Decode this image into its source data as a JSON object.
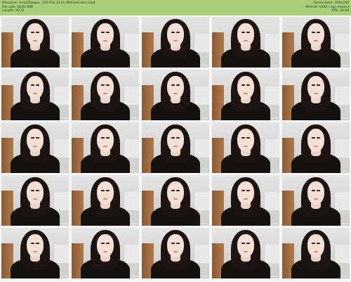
{
  "header": {
    "filename_line": "Filename: snmrj/fongus _241218_1114_MyFreeCams.mp4",
    "filesize_line": "File size: 18.65 MiB",
    "length_line": "Length: 00:21",
    "dimensions_line": "Dimensions: 320x240",
    "format_line": "Format: h264 / aac (mono)",
    "fps_line": "FPS: 24.00"
  },
  "colors": {
    "header_bg": "#a9cf7a",
    "page_bg": "#f6f6f6",
    "top_wall": "#e4e4e2"
  },
  "thumbnails": [
    {
      "watermark": "",
      "time": "00:01"
    },
    {
      "watermark": "",
      "time": "00:02"
    },
    {
      "watermark": "",
      "time": "00:03"
    },
    {
      "watermark": "",
      "time": "00:04"
    },
    {
      "watermark": "",
      "time": "00:05"
    },
    {
      "watermark": "",
      "time": "00:06"
    },
    {
      "watermark": "",
      "time": "00:07"
    },
    {
      "watermark": "",
      "time": "00:08"
    },
    {
      "watermark": "",
      "time": "00:09"
    },
    {
      "watermark": "",
      "time": "00:10"
    },
    {
      "watermark": "",
      "time": "00:11"
    },
    {
      "watermark": "",
      "time": "00:12"
    },
    {
      "watermark": "",
      "time": "00:12"
    },
    {
      "watermark": "",
      "time": "00:13"
    },
    {
      "watermark": "",
      "time": "00:14"
    },
    {
      "watermark": "",
      "time": "00:15"
    },
    {
      "watermark": "",
      "time": "00:16"
    },
    {
      "watermark": "",
      "time": "00:16"
    },
    {
      "watermark": "",
      "time": "00:17"
    },
    {
      "watermark": "",
      "time": "00:18"
    },
    {
      "watermark": "",
      "time": "00:19"
    },
    {
      "watermark": "",
      "time": "00:20"
    },
    {
      "watermark": "",
      "time": "00:20"
    },
    {
      "watermark": "",
      "time": "00:21"
    },
    {
      "watermark": "",
      "time": "00:21"
    }
  ]
}
